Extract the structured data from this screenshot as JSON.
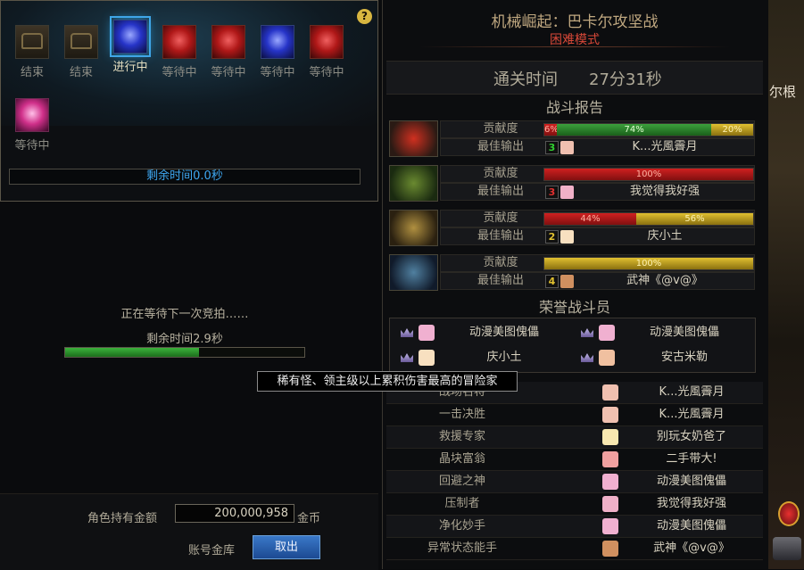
{
  "auction": {
    "help": "?",
    "items": [
      {
        "label": "结束",
        "icon": "chest-icon",
        "kind": "chest"
      },
      {
        "label": "结束",
        "icon": "chest-icon",
        "kind": "chest"
      },
      {
        "label": "进行中",
        "icon": "blue-crystal-icon",
        "kind": "blue",
        "selected": true
      },
      {
        "label": "等待中",
        "icon": "red-crystal-icon",
        "kind": "red"
      },
      {
        "label": "等待中",
        "icon": "red-crystal-icon",
        "kind": "red"
      },
      {
        "label": "等待中",
        "icon": "blue-crystal-icon",
        "kind": "blue"
      },
      {
        "label": "等待中",
        "icon": "red-crystal-icon",
        "kind": "red"
      },
      {
        "label": "等待中",
        "icon": "pink-orb-icon",
        "kind": "pink"
      }
    ],
    "remaining": "剩余时间0.0秒"
  },
  "waiting": {
    "text": "正在等待下一次竞拍……",
    "remaining": "剩余时间2.9秒",
    "progress": 0.56
  },
  "gold": {
    "label": "角色持有金额",
    "value": "200,000,958",
    "unit": "金币",
    "bank_label": "账号金库",
    "withdraw": "取出"
  },
  "report": {
    "dungeon": "机械崛起：巴卡尔攻坚战",
    "difficulty": "困难模式",
    "clear_label": "通关时间",
    "clear_time": "27分31秒",
    "battle_title": "战斗报告",
    "contribution_label": "贡献度",
    "best_output_label": "最佳输出",
    "parties": [
      {
        "avatar": "red-warrior-avatar",
        "colors": [
          "#d03020",
          "#2a1a14"
        ],
        "segments": [
          {
            "pct": 6,
            "label": "6%",
            "color": "red"
          },
          {
            "pct": 74,
            "label": "74%",
            "color": "green"
          },
          {
            "pct": 20,
            "label": "20%",
            "color": "yellow"
          }
        ],
        "rank": "3",
        "rank_color": "#30d030",
        "face": "#f0c0b0",
        "player": "K...光風霽月"
      },
      {
        "avatar": "green-warrior-avatar",
        "colors": [
          "#6a8a30",
          "#1a2a10"
        ],
        "segments": [
          {
            "pct": 100,
            "label": "100%",
            "color": "red"
          }
        ],
        "rank": "3",
        "rank_color": "#e03030",
        "face": "#f0b0c8",
        "player": "我觉得我好强"
      },
      {
        "avatar": "gold-warrior-avatar",
        "colors": [
          "#b09040",
          "#2a2010"
        ],
        "segments": [
          {
            "pct": 44,
            "label": "44%",
            "color": "red"
          },
          {
            "pct": 56,
            "label": "56%",
            "color": "yellow"
          }
        ],
        "rank": "2",
        "rank_color": "#e0c030",
        "face": "#f8e0c0",
        "player": "庆小土"
      },
      {
        "avatar": "blue-warrior-avatar",
        "colors": [
          "#5080a0",
          "#101a2a"
        ],
        "segments": [
          {
            "pct": 100,
            "label": "100%",
            "color": "yellow"
          }
        ],
        "rank": "4",
        "rank_color": "#e0c030",
        "face": "#d09060",
        "player": "武神《@v@》"
      }
    ],
    "honor_title": "荣誉战斗员",
    "honor": [
      {
        "name": "动漫美图傀儡",
        "face": "#f0b0d0"
      },
      {
        "name": "动漫美图傀儡",
        "face": "#f0b0d0"
      },
      {
        "name": "庆小土",
        "face": "#f8e0c0"
      },
      {
        "name": "安古米勒",
        "face": "#f0c0a0"
      }
    ],
    "awards": [
      {
        "title": "战场名将",
        "name": "K...光風霽月",
        "face": "#f0c0b0"
      },
      {
        "title": "一击决胜",
        "name": "K...光風霽月",
        "face": "#f0c0b0"
      },
      {
        "title": "救援专家",
        "name": "别玩女奶爸了",
        "face": "#f8e8b0"
      },
      {
        "title": "晶块富翁",
        "name": "二手带大!",
        "face": "#f0a0a0"
      },
      {
        "title": "回避之神",
        "name": "动漫美图傀儡",
        "face": "#f0b0d0"
      },
      {
        "title": "压制者",
        "name": "我觉得我好强",
        "face": "#f0b0c8"
      },
      {
        "title": "净化妙手",
        "name": "动漫美图傀儡",
        "face": "#f0b0d0"
      },
      {
        "title": "异常状态能手",
        "name": "武神《@v@》",
        "face": "#d09060"
      }
    ]
  },
  "tooltip": "稀有怪、领主级以上累积伤害最高的冒险家",
  "scene": {
    "text": "尔根"
  }
}
